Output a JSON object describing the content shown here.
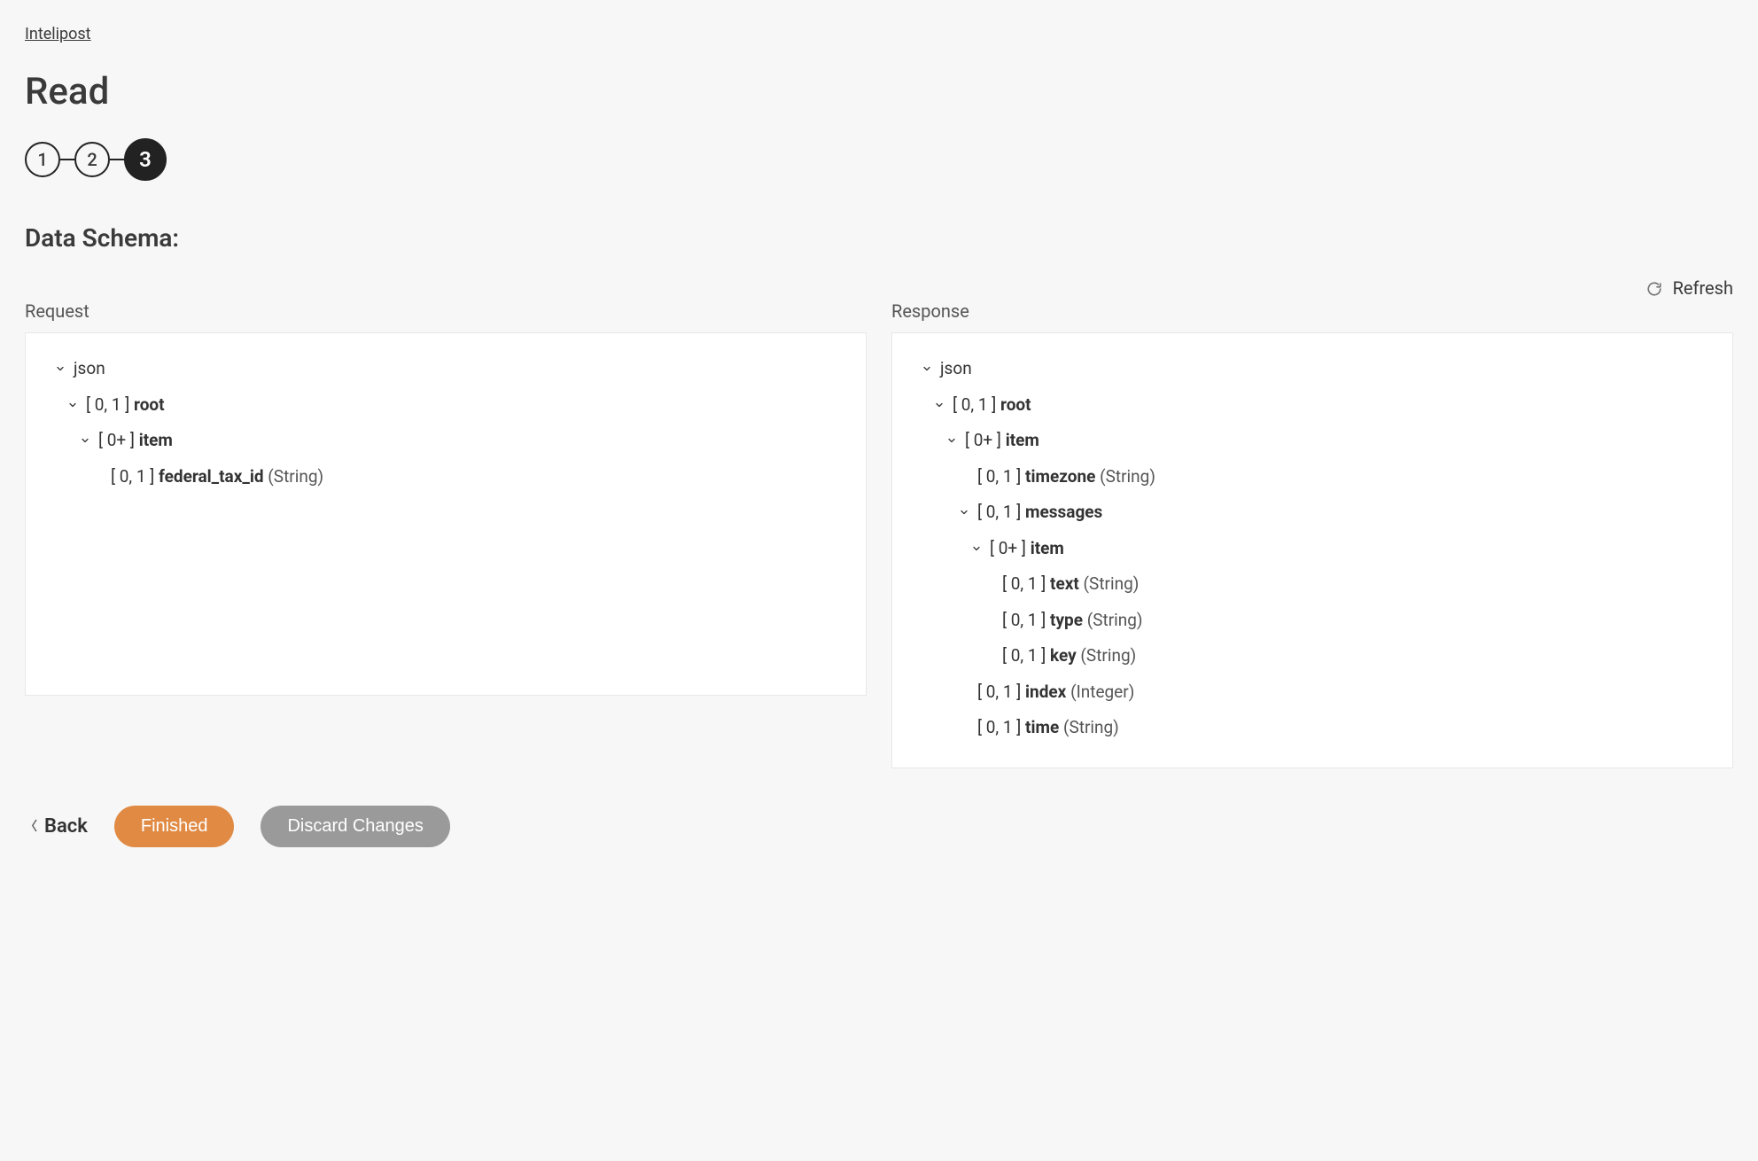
{
  "breadcrumb": {
    "label": "Intelipost"
  },
  "title": "Read",
  "stepper": {
    "steps": [
      "1",
      "2",
      "3"
    ],
    "active_index": 2
  },
  "section_title": "Data Schema:",
  "refresh_label": "Refresh",
  "columns": {
    "request": "Request",
    "response": "Response"
  },
  "request_tree": [
    {
      "indent": 0,
      "chevron": true,
      "cardinality": "",
      "name": "json",
      "type": ""
    },
    {
      "indent": 1,
      "chevron": true,
      "cardinality": "[ 0, 1 ]",
      "name": "root",
      "type": ""
    },
    {
      "indent": 2,
      "chevron": true,
      "cardinality": "[ 0+ ]",
      "name": "item",
      "type": ""
    },
    {
      "indent": 3,
      "chevron": false,
      "cardinality": "[ 0, 1 ]",
      "name": "federal_tax_id",
      "type": "(String)"
    }
  ],
  "response_tree": [
    {
      "indent": 0,
      "chevron": true,
      "cardinality": "",
      "name": "json",
      "type": ""
    },
    {
      "indent": 1,
      "chevron": true,
      "cardinality": "[ 0, 1 ]",
      "name": "root",
      "type": ""
    },
    {
      "indent": 2,
      "chevron": true,
      "cardinality": "[ 0+ ]",
      "name": "item",
      "type": ""
    },
    {
      "indent": 3,
      "chevron": false,
      "cardinality": "[ 0, 1 ]",
      "name": "timezone",
      "type": "(String)"
    },
    {
      "indent": 3,
      "chevron": true,
      "cardinality": "[ 0, 1 ]",
      "name": "messages",
      "type": ""
    },
    {
      "indent": 4,
      "chevron": true,
      "cardinality": "[ 0+ ]",
      "name": "item",
      "type": ""
    },
    {
      "indent": 5,
      "chevron": false,
      "cardinality": "[ 0, 1 ]",
      "name": "text",
      "type": "(String)"
    },
    {
      "indent": 5,
      "chevron": false,
      "cardinality": "[ 0, 1 ]",
      "name": "type",
      "type": "(String)"
    },
    {
      "indent": 5,
      "chevron": false,
      "cardinality": "[ 0, 1 ]",
      "name": "key",
      "type": "(String)"
    },
    {
      "indent": 3,
      "chevron": false,
      "cardinality": "[ 0, 1 ]",
      "name": "index",
      "type": "(Integer)"
    },
    {
      "indent": 3,
      "chevron": false,
      "cardinality": "[ 0, 1 ]",
      "name": "time",
      "type": "(String)"
    }
  ],
  "footer": {
    "back": "Back",
    "finished": "Finished",
    "discard": "Discard Changes"
  }
}
